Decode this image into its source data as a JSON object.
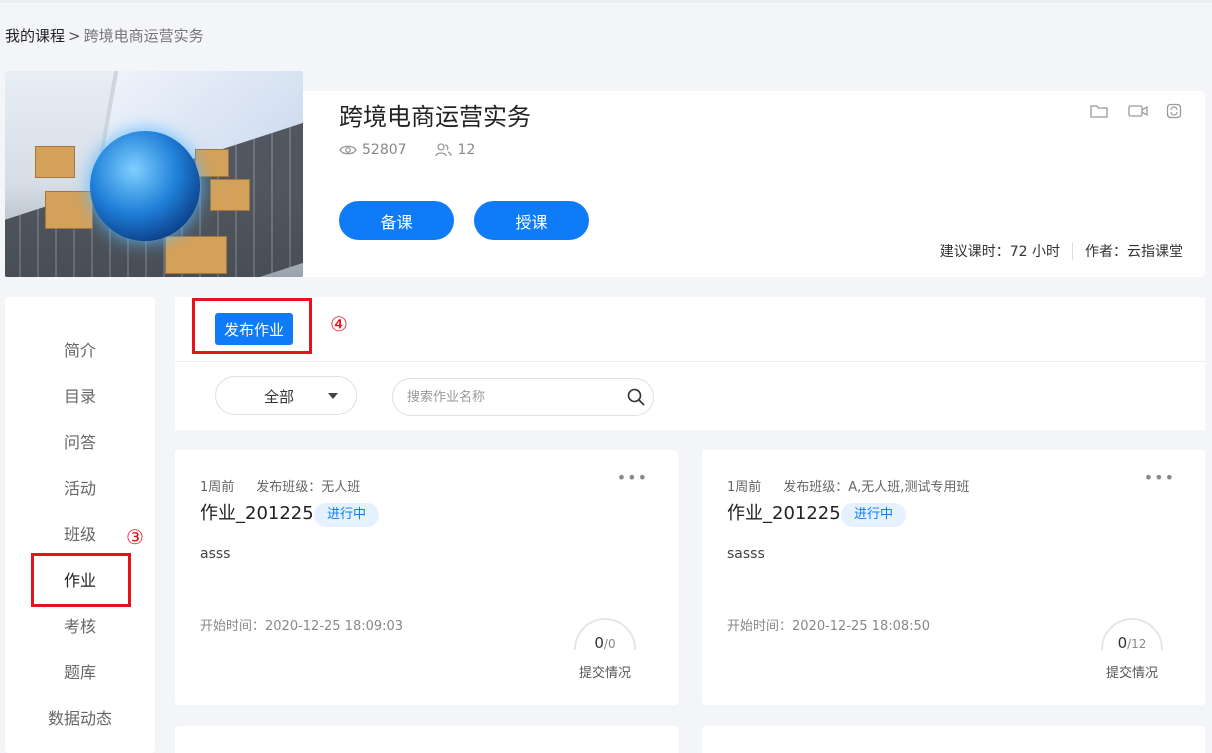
{
  "breadcrumb": {
    "root": "我的课程",
    "separator": ">",
    "current": "跨境电商运营实务"
  },
  "course": {
    "title": "跨境电商运营实务",
    "views": "52807",
    "members": "12",
    "prep_button": "备课",
    "teach_button": "授课",
    "hours_label": "建议课时：",
    "hours_value": "72 小时",
    "author_label": "作者：",
    "author_value": "云指课堂",
    "top_icons": [
      "folder-icon",
      "video-icon",
      "sync-icon"
    ]
  },
  "sidenav": {
    "items": [
      "简介",
      "目录",
      "问答",
      "活动",
      "班级",
      "作业",
      "考核",
      "题库",
      "数据动态"
    ],
    "active_index": 5
  },
  "annotations": {
    "step3": "③",
    "step4": "④",
    "highlight_color": "#e5141b"
  },
  "toolbar": {
    "publish_button": "发布作业",
    "filter_value": "全部",
    "search_placeholder": "搜索作业名称"
  },
  "assignments": [
    {
      "time_ago": "1周前",
      "class_label": "发布班级：无人班",
      "title": "作业_201225",
      "status": "进行中",
      "desc": "asss",
      "start_time": "开始时间：2020-12-25 18:09:03",
      "submitted": "0",
      "total": "/0",
      "submit_label": "提交情况"
    },
    {
      "time_ago": "1周前",
      "class_label": "发布班级：A,无人班,测试专用班",
      "title": "作业_201225",
      "status": "进行中",
      "desc": "sasss",
      "start_time": "开始时间：2020-12-25 18:08:50",
      "submitted": "0",
      "total": "/12",
      "submit_label": "提交情况"
    }
  ],
  "colors": {
    "primary": "#0f7bf7",
    "background": "#f4f5f8"
  }
}
